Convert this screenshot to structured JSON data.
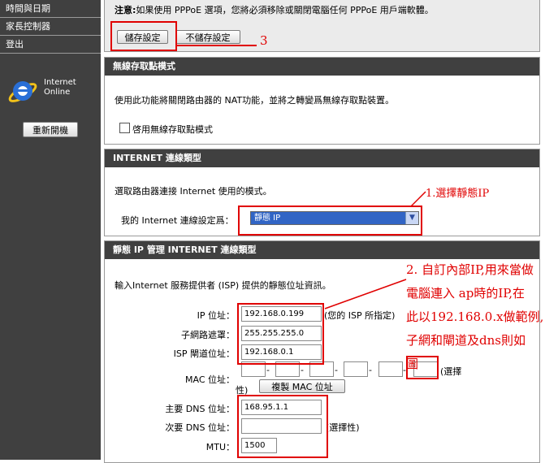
{
  "sidebar": {
    "items": [
      "時間與日期",
      "家長控制器",
      "登出"
    ],
    "internet_status": {
      "line1": "Internet",
      "line2": "Online"
    },
    "reconnect_label": "重新開機"
  },
  "notice": {
    "prefix": "注意:",
    "text": "如果使用 PPPoE 選項，您將必須移除或關閉電腦任何 PPPoE 用戶端軟體。",
    "save_label": "儲存設定",
    "nosave_label": "不儲存設定"
  },
  "ap_mode": {
    "title": "無線存取點模式",
    "desc": "使用此功能將關閉路由器的 NAT功能，並將之轉變爲無線存取點裝置。",
    "checkbox_label": "啓用無線存取點模式"
  },
  "conn_type": {
    "title": "INTERNET 連線類型",
    "desc": "選取路由器連接 Internet 使用的模式。",
    "label": "我的 Internet 連線設定爲：",
    "selected": "靜態 IP"
  },
  "static_ip": {
    "title": "靜態 IP 管理 INTERNET 連線類型",
    "desc": "輸入Internet 服務提供者 (ISP) 提供的靜態位址資訊。",
    "ip_label": "IP 位址：",
    "ip_value": "192.168.0.199",
    "ip_note": "(您的 ISP 所指定)",
    "mask_label": "子網路遮罩：",
    "mask_value": "255.255.255.0",
    "gw_label": "ISP 閘道位址：",
    "gw_value": "192.168.0.1",
    "mac_label": "MAC 位址：",
    "mac_sep": "-",
    "mac_note1": "(選擇",
    "mac_note2": "性)",
    "copy_mac_label": "複製 MAC 位址",
    "dns1_label": "主要 DNS 位址：",
    "dns1_value": "168.95.1.1",
    "dns2_label": "次要 DNS 位址：",
    "dns2_value": "",
    "dns2_note": "(選擇性)",
    "mtu_label": "MTU：",
    "mtu_value": "1500"
  },
  "annotations": {
    "step3": "3",
    "step1": "1.選擇靜態IP",
    "step2_lines": [
      "2. 自訂內部IP,用來當做",
      "電腦連入 ap時的IP,在",
      "此以192.168.0.x做範例,",
      "子網和閘道及dns則如",
      "圖"
    ]
  },
  "colors": {
    "header_bg": "#404040",
    "sidebar_bg": "#404040",
    "annotation_red": "#e00000",
    "select_blue": "#3165c5"
  }
}
